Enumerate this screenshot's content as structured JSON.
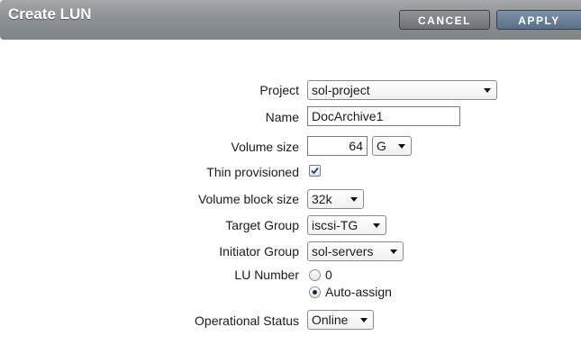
{
  "header": {
    "title": "Create LUN",
    "cancel_label": "CANCEL",
    "apply_label": "APPLY"
  },
  "form": {
    "project": {
      "label": "Project",
      "value": "sol-project"
    },
    "name": {
      "label": "Name",
      "value": "DocArchive1"
    },
    "volume_size": {
      "label": "Volume size",
      "value": "64",
      "unit": "G"
    },
    "thin_provisioned": {
      "label": "Thin provisioned",
      "checked": true
    },
    "volume_block_size": {
      "label": "Volume block size",
      "value": "32k"
    },
    "target_group": {
      "label": "Target Group",
      "value": "iscsi-TG"
    },
    "initiator_group": {
      "label": "Initiator Group",
      "value": "sol-servers"
    },
    "lu_number": {
      "label": "LU Number",
      "options": [
        {
          "label": "0",
          "selected": false
        },
        {
          "label": "Auto-assign",
          "selected": true
        }
      ]
    },
    "operational_status": {
      "label": "Operational Status",
      "value": "Online"
    }
  }
}
